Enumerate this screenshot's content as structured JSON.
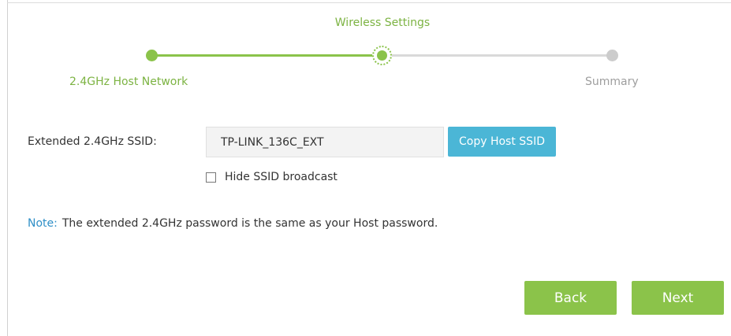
{
  "stepper": {
    "title": "Wireless Settings",
    "steps": [
      {
        "label": "2.4GHz Host Network",
        "state": "done"
      },
      {
        "label": "",
        "state": "current"
      },
      {
        "label": "Summary",
        "state": "todo"
      }
    ]
  },
  "form": {
    "ssid_label": "Extended 2.4GHz SSID:",
    "ssid_value": "TP-LINK_136C_EXT",
    "copy_button_label": "Copy Host SSID",
    "hide_ssid_label": "Hide SSID broadcast",
    "hide_ssid_checked": false
  },
  "note": {
    "prefix": "Note:",
    "text": "The extended 2.4GHz password is the same as your Host password."
  },
  "actions": {
    "back_label": "Back",
    "next_label": "Next"
  },
  "colors": {
    "accent_green": "#8bc34a",
    "info_blue": "#4bb6d6",
    "note_blue": "#2f8fc7",
    "inactive_gray": "#cccccc"
  }
}
